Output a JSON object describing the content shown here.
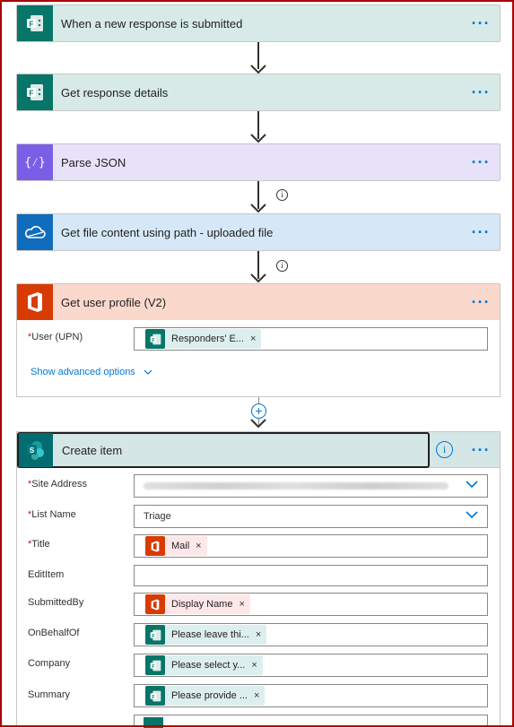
{
  "steps": {
    "trigger": {
      "title": "When a new response is submitted",
      "menu": "···"
    },
    "get_details": {
      "title": "Get response details",
      "menu": "···"
    },
    "parse_json": {
      "title": "Parse JSON",
      "menu": "···"
    },
    "get_file": {
      "title": "Get file content using path - uploaded file",
      "menu": "···"
    },
    "get_user": {
      "title": "Get user profile (V2)",
      "menu": "···",
      "fields": {
        "upn_label": "User (UPN)",
        "upn_token": "Responders' E..."
      },
      "advanced": "Show advanced options"
    },
    "create_item": {
      "title": "Create item",
      "menu": "···",
      "fields": {
        "site_address_label": "Site Address",
        "list_name_label": "List Name",
        "list_name_value": "Triage",
        "title_label": "Title",
        "title_token": "Mail",
        "edititem_label": "EditItem",
        "submittedby_label": "SubmittedBy",
        "submittedby_token": "Display Name",
        "onbehalfof_label": "OnBehalfOf",
        "onbehalfof_token": "Please leave thi...",
        "company_label": "Company",
        "company_token": "Please select y...",
        "summary_label": "Summary",
        "summary_token": "Please provide ..."
      }
    }
  },
  "info_glyph": "i",
  "add_glyph": "+",
  "required_mark": "*",
  "token_remove": "×",
  "colors": {
    "forms_green": "#077568",
    "forms_header": "#d7eae8",
    "parse_purple": "#7a5fe6",
    "parse_header": "#e7e2fa",
    "onedrive_blue": "#0f6cbd",
    "onedrive_header": "#d6e8f7",
    "office_red": "#d83b01",
    "office_header": "#fbd8cc",
    "sharepoint_teal": "#036c70",
    "sharepoint_header": "#d5e6e6",
    "link_blue": "#0078d4"
  }
}
